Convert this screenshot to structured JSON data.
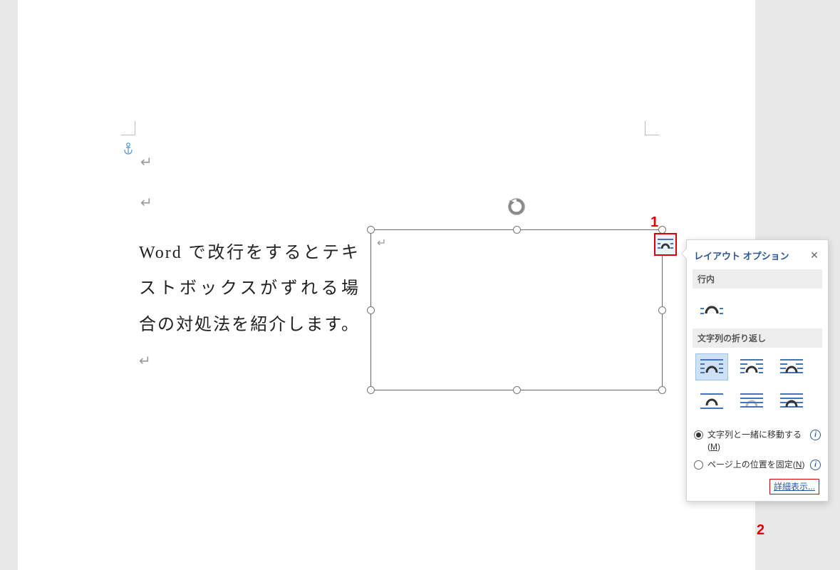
{
  "document": {
    "paragraph_text": "Word で改行をするとテキストボックスがずれる場合の対処法を紹介します。"
  },
  "annotations": {
    "label1": "1",
    "label2": "2"
  },
  "layout_options": {
    "title": "レイアウト オプション",
    "section_inline": "行内",
    "section_wrap": "文字列の折り返し",
    "radio_move_with_text": "文字列と一緒に移動する(",
    "radio_move_key": "M",
    "radio_move_suffix": ")",
    "radio_fix_position": "ページ上の位置を固定(",
    "radio_fix_key": "N",
    "radio_fix_suffix": ")",
    "detail_link": "詳細表示..."
  }
}
